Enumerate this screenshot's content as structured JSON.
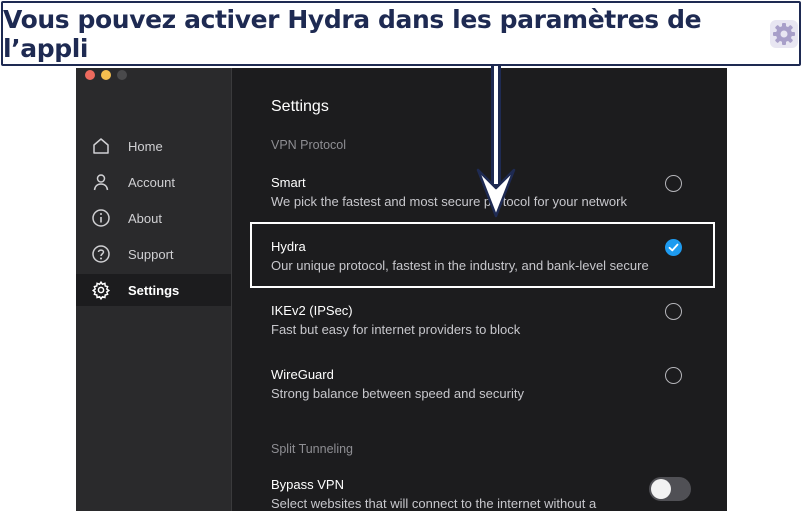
{
  "banner": {
    "text": "Vous pouvez activer Hydra dans les paramètres de l’appli",
    "icon": "gear-icon"
  },
  "sidebar": {
    "items": [
      {
        "label": "Home",
        "icon": "home-icon",
        "active": false
      },
      {
        "label": "Account",
        "icon": "person-icon",
        "active": false
      },
      {
        "label": "About",
        "icon": "info-icon",
        "active": false
      },
      {
        "label": "Support",
        "icon": "help-icon",
        "active": false
      },
      {
        "label": "Settings",
        "icon": "gear-icon",
        "active": true
      }
    ]
  },
  "main": {
    "title": "Settings",
    "vpn_protocol_label": "VPN Protocol",
    "protocols": [
      {
        "name": "Smart",
        "description": "We pick the fastest and most secure protocol for your network",
        "selected": false
      },
      {
        "name": "Hydra",
        "description": "Our unique protocol, fastest in the industry, and bank-level secure",
        "selected": true
      },
      {
        "name": "IKEv2 (IPSec)",
        "description": "Fast but easy for internet providers to block",
        "selected": false
      },
      {
        "name": "WireGuard",
        "description": "Strong balance between speed and security",
        "selected": false
      }
    ],
    "split_tunneling_label": "Split Tunneling",
    "bypass": {
      "name": "Bypass VPN",
      "description": "Select websites that will connect to the internet without a",
      "enabled": false
    }
  },
  "colors": {
    "accent": "#1e9bf0",
    "banner_text": "#1e2a52",
    "app_background": "#1c1c1e",
    "sidebar_background": "#2a2a2c"
  }
}
